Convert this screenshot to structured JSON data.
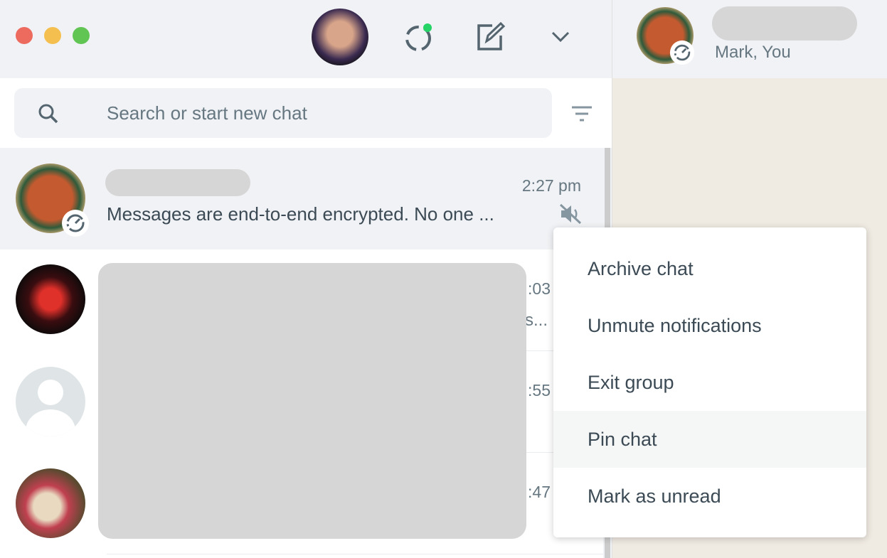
{
  "window": {
    "controls": [
      "close",
      "minimize",
      "zoom"
    ]
  },
  "header": {
    "icons": [
      "profile-avatar",
      "status-icon",
      "new-chat-icon",
      "chevron-down-icon"
    ],
    "status_dot_color": "#25d366"
  },
  "search": {
    "placeholder": "Search or start new chat"
  },
  "chats": [
    {
      "time": "2:27 pm",
      "preview": "Messages are end-to-end encrypted. No one ...",
      "muted": true
    },
    {
      "time": ":03",
      "preview": "s..."
    },
    {
      "time": ":55",
      "preview": ""
    },
    {
      "time": ":47",
      "preview": ""
    }
  ],
  "conversation": {
    "subtitle": "Mark, You"
  },
  "context_menu": {
    "items": [
      "Archive chat",
      "Unmute notifications",
      "Exit group",
      "Pin chat",
      "Mark as unread"
    ],
    "highlighted": "Pin chat"
  }
}
